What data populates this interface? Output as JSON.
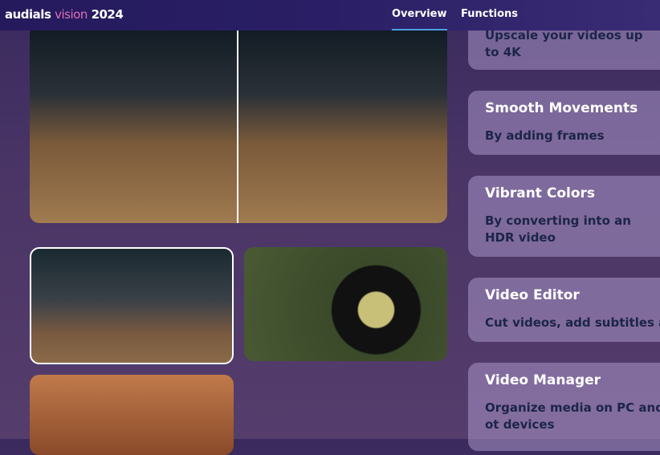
{
  "header": {
    "logo_part1": "audials",
    "logo_part2": "vision",
    "logo_part3": "2024",
    "nav": [
      {
        "label": "Overview",
        "active": true
      },
      {
        "label": "Functions",
        "active": false
      }
    ]
  },
  "cards": [
    {
      "title": "",
      "desc": "Upscale your videos up to 4K"
    },
    {
      "title": "Smooth Movements",
      "desc": "By adding frames"
    },
    {
      "title": "Vibrant Colors",
      "desc": "By converting into an HDR video"
    },
    {
      "title": "Video Editor",
      "desc": "Cut videos, add subtitles and"
    },
    {
      "title": "Video Manager",
      "desc": "Organize media on PC and ot devices"
    }
  ],
  "media": [
    "basketball-comparison",
    "basketball-thumbnail",
    "toucan-thumbnail",
    "desert-astronaut-thumbnail"
  ]
}
